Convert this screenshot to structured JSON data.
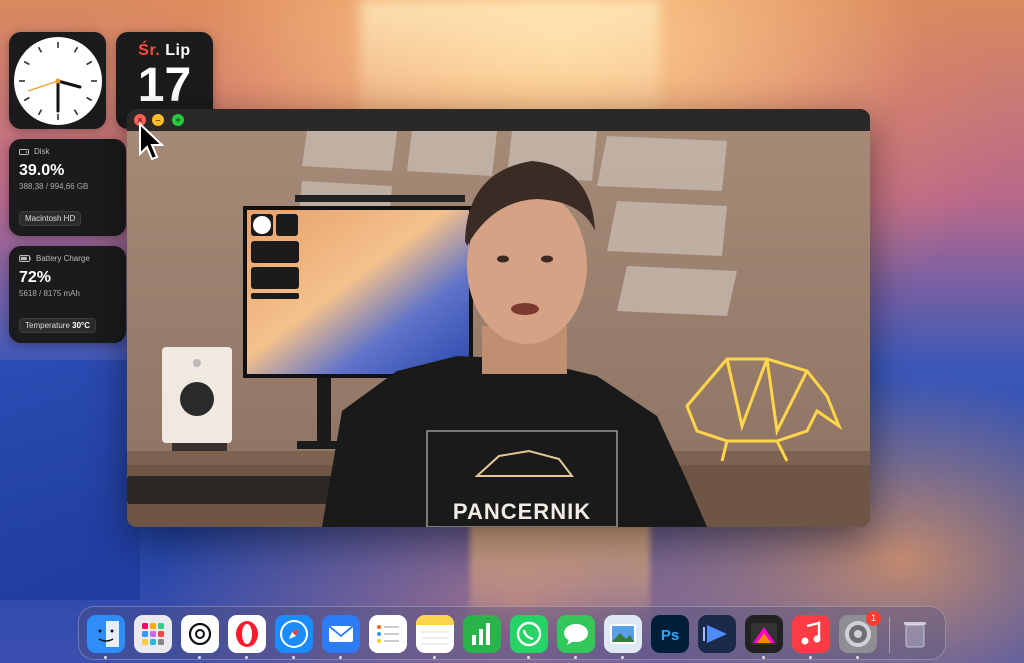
{
  "desktop": {
    "name": "macOS desktop"
  },
  "widgets": {
    "clock": {
      "time_hour": 3,
      "time_minute": 10
    },
    "calendar": {
      "weekday": "Śr.",
      "month": "Lip",
      "date": "17"
    },
    "disk": {
      "label": "Disk",
      "percent": "39.0%",
      "usage": "388,38 / 994,66 GB",
      "volume": "Macintosh HD"
    },
    "battery": {
      "label": "Battery Charge",
      "percent": "72%",
      "capacity": "5618 / 8175 mAh",
      "temp_label": "Temperature",
      "temp_value": "30°C"
    }
  },
  "window": {
    "controls": {
      "close": "×",
      "minimize": "–",
      "zoom": "+"
    },
    "shirt_text": "PANCERNIK"
  },
  "dock": {
    "apps": [
      {
        "id": "finder",
        "color": "#2f8dfa",
        "running": true
      },
      {
        "id": "launchpad",
        "color": "#e9e9ef",
        "running": false
      },
      {
        "id": "chatgpt",
        "color": "#ffffff",
        "running": true
      },
      {
        "id": "opera",
        "color": "#ffffff",
        "running": true
      },
      {
        "id": "safari",
        "color": "#1a8cff",
        "running": true
      },
      {
        "id": "mail",
        "color": "#2d7cf6",
        "running": true
      },
      {
        "id": "reminders",
        "color": "#ffffff",
        "running": false
      },
      {
        "id": "notes",
        "color": "#ffffff",
        "running": true
      },
      {
        "id": "numbers",
        "color": "#29b34a",
        "running": false
      },
      {
        "id": "whatsapp",
        "color": "#25d366",
        "running": true
      },
      {
        "id": "messages",
        "color": "#34c759",
        "running": true
      },
      {
        "id": "preview",
        "color": "#dfe8f3",
        "running": true
      },
      {
        "id": "photoshop",
        "color": "#001e36",
        "running": false
      },
      {
        "id": "screencast",
        "color": "#1a2a48",
        "running": false
      },
      {
        "id": "final-cut",
        "color": "#222222",
        "running": true
      },
      {
        "id": "music",
        "color": "#fc3c44",
        "running": true
      },
      {
        "id": "system-settings",
        "color": "#8e8e93",
        "running": true,
        "badge": "1"
      },
      {
        "id": "trash",
        "color": "#5a6a8a",
        "running": false
      }
    ]
  }
}
